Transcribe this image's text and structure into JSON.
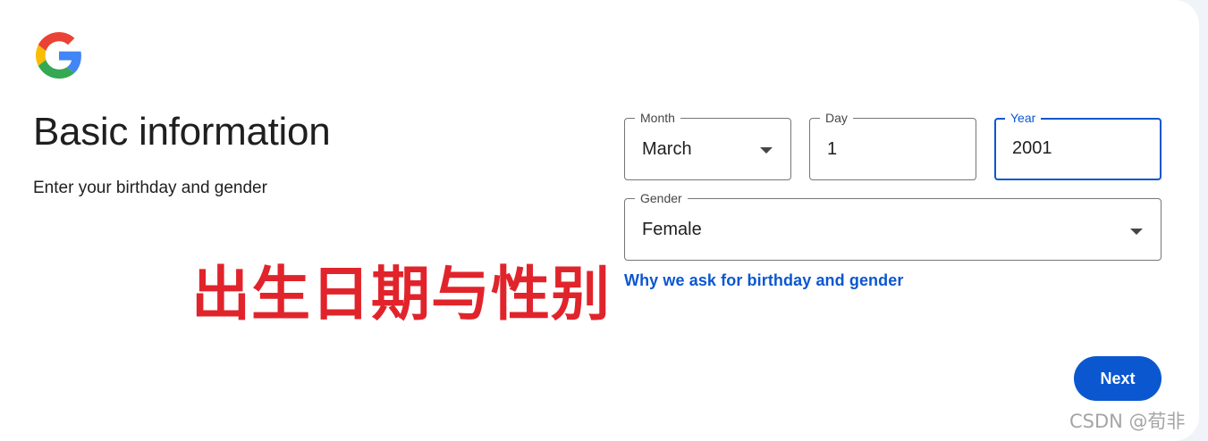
{
  "brand": {
    "logo_icon": "google-g-logo-icon",
    "colors": {
      "blue": "#4285F4",
      "red": "#EA4335",
      "yellow": "#FBBC05",
      "green": "#34A853"
    }
  },
  "page": {
    "title": "Basic information",
    "subtitle": "Enter your birthday and gender"
  },
  "annotation": {
    "text": "出生日期与性别",
    "color": "#e1242b"
  },
  "form": {
    "month": {
      "label": "Month",
      "value": "March",
      "icon": "dropdown-arrow-icon"
    },
    "day": {
      "label": "Day",
      "value": "1"
    },
    "year": {
      "label": "Year",
      "value": "2001",
      "focused": true
    },
    "gender": {
      "label": "Gender",
      "value": "Female",
      "icon": "dropdown-arrow-icon"
    },
    "why_link": "Why we ask for birthday and gender"
  },
  "actions": {
    "next_label": "Next",
    "accent_color": "#0b57d0"
  },
  "watermark": {
    "text": "CSDN @荀非"
  }
}
